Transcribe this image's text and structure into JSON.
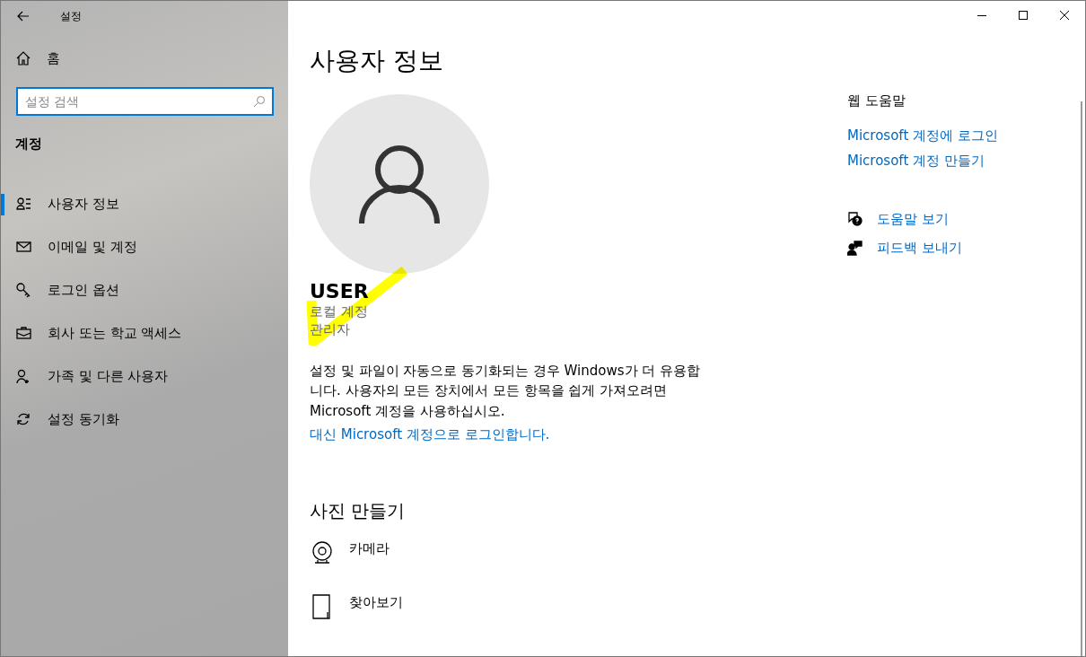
{
  "window": {
    "title": "설정"
  },
  "sidebar": {
    "home": "홈",
    "search": {
      "placeholder": "설정 검색"
    },
    "section": "계정",
    "items": [
      {
        "label": "사용자 정보",
        "selected": true
      },
      {
        "label": "이메일 및 계정",
        "selected": false
      },
      {
        "label": "로그인 옵션",
        "selected": false
      },
      {
        "label": "회사 또는 학교 액세스",
        "selected": false
      },
      {
        "label": "가족 및 다른 사용자",
        "selected": false
      },
      {
        "label": "설정 동기화",
        "selected": false
      }
    ]
  },
  "main": {
    "title": "사용자 정보",
    "user": {
      "name": "USER",
      "details": [
        "로컬 계정",
        "관리자"
      ]
    },
    "description": "설정 및 파일이 자동으로 동기화되는 경우 Windows가 더 유용합니다. 사용자의 모든 장치에서 모든 항목을 쉽게 가져오려면 Microsoft 계정을 사용하십시오.",
    "link": "대신 Microsoft 계정으로 로그인합니다.",
    "photo_section": {
      "title": "사진 만들기",
      "items": [
        {
          "label": "카메라"
        },
        {
          "label": "찾아보기"
        }
      ]
    }
  },
  "help": {
    "title": "웹 도움말",
    "links": [
      "Microsoft 계정에 로그인",
      "Microsoft 계정 만들기"
    ],
    "actions": [
      {
        "label": "도움말 보기"
      },
      {
        "label": "피드백 보내기"
      }
    ]
  }
}
